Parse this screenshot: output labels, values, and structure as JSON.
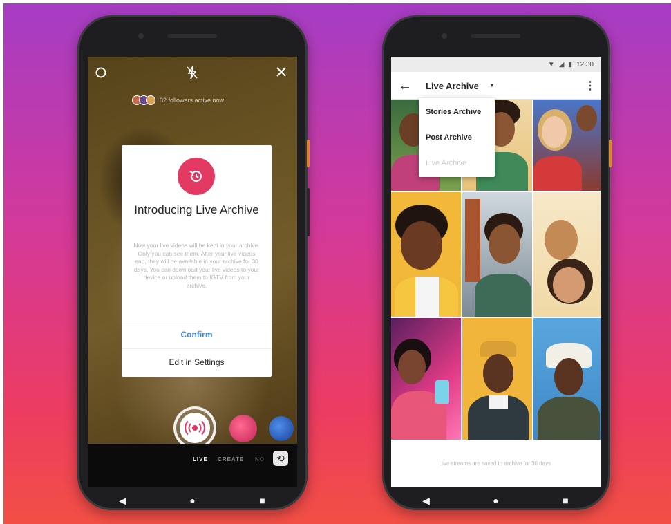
{
  "left_phone": {
    "dialog": {
      "title": "Introducing Live Archive",
      "body": "Now your live videos will be kept in your archive. Only you can see them. After your live videos end, they will be available in your archive for 30 days. You can download your live videos to your device or upload them to IGTV from your archive.",
      "confirm_label": "Confirm",
      "settings_label": "Edit in Settings"
    },
    "viewers_text": "32 followers active now",
    "mode_tabs": [
      "LIVE",
      "CREATE",
      "NO"
    ],
    "icons": {
      "settings": "settings-icon",
      "flash": "flash-off-icon",
      "close": "close-icon",
      "archive": "archive-history-icon",
      "shutter": "live-broadcast-icon",
      "flip": "flip-camera-icon"
    }
  },
  "right_phone": {
    "status_time": "12:30",
    "title": "Live Archive",
    "dropdown_items": [
      {
        "label": "Stories Archive",
        "enabled": true
      },
      {
        "label": "Post Archive",
        "enabled": true
      },
      {
        "label": "Live Archive",
        "enabled": false
      }
    ],
    "footer_text": "Live streams are saved to archive for 30 days."
  },
  "navigation": {
    "back": "◀",
    "home": "●",
    "recents": "■"
  },
  "colors": {
    "background_top": "#a53dc4",
    "background_bottom": "#f24f44",
    "accent_red": "#e23a62",
    "confirm_blue": "#3d8ee6"
  }
}
